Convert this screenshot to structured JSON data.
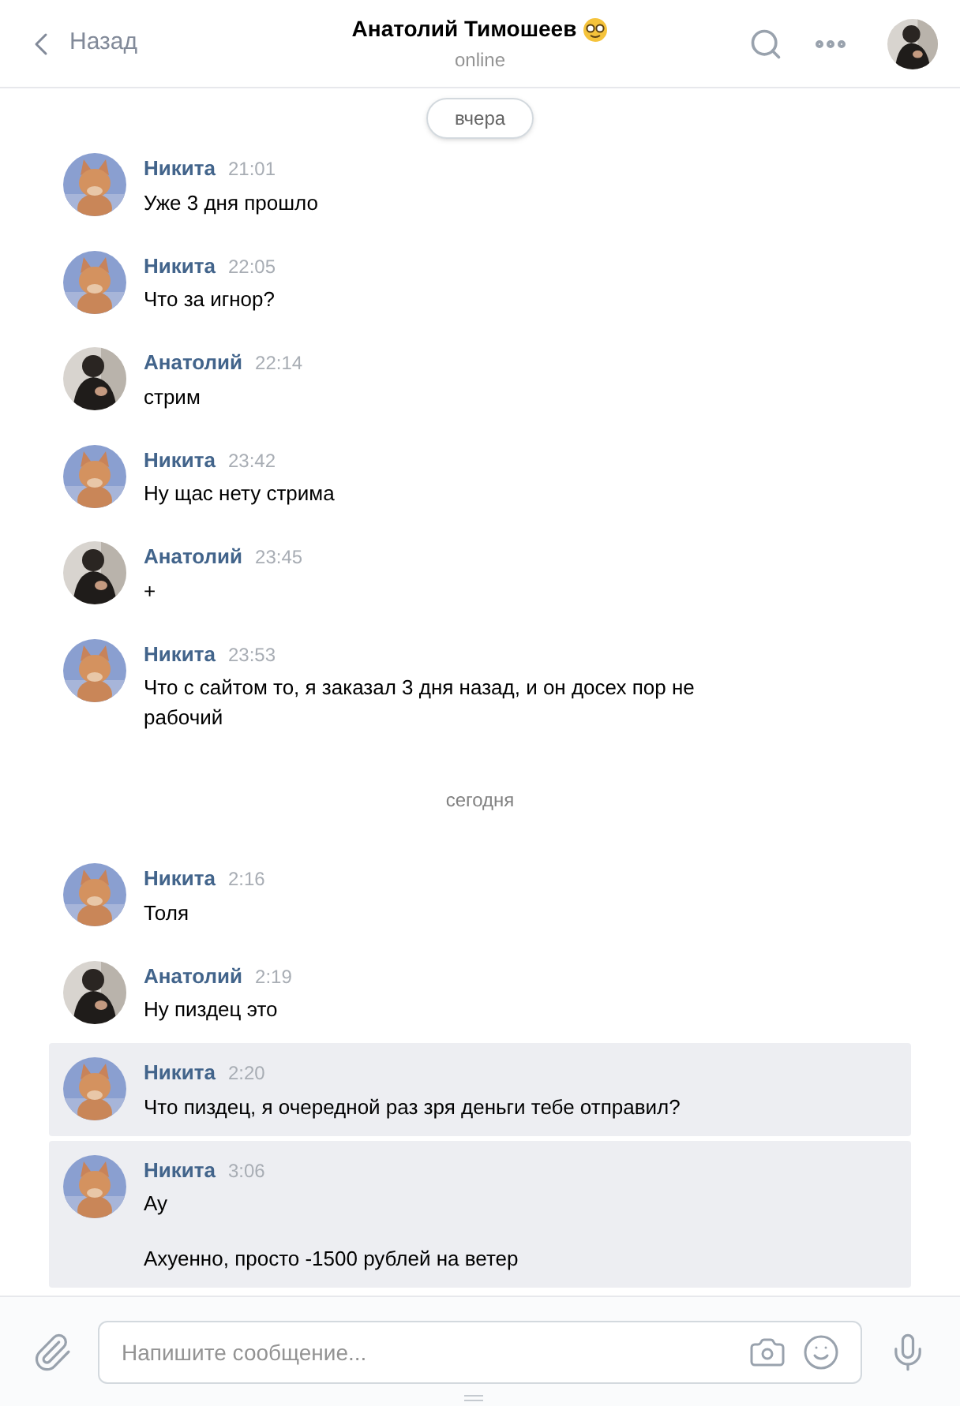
{
  "header": {
    "back_label": "Назад",
    "title": "Анатолий Тимошеев",
    "status": "online"
  },
  "feed": [
    {
      "kind": "pill_date",
      "label": "вчера"
    },
    {
      "kind": "own_message",
      "author": "Никита",
      "time": "21:01",
      "selected": false,
      "paragraphs": [
        "Уже 3 дня прошло"
      ]
    },
    {
      "kind": "own_message",
      "author": "Никита",
      "time": "22:05",
      "selected": false,
      "paragraphs": [
        "Что за игнор?"
      ]
    },
    {
      "kind": "peer_message",
      "author": "Анатолий",
      "time": "22:14",
      "selected": false,
      "paragraphs": [
        "стрим"
      ]
    },
    {
      "kind": "own_message",
      "author": "Никита",
      "time": "23:42",
      "selected": false,
      "paragraphs": [
        "Ну щас нету стрима"
      ]
    },
    {
      "kind": "peer_message",
      "author": "Анатолий",
      "time": "23:45",
      "selected": false,
      "paragraphs": [
        "+"
      ]
    },
    {
      "kind": "own_message",
      "author": "Никита",
      "time": "23:53",
      "selected": false,
      "paragraphs": [
        "Что с сайтом то, я заказал 3 дня назад, и он досех пор не рабочий"
      ]
    },
    {
      "kind": "plain_date",
      "label": "сегодня"
    },
    {
      "kind": "own_message",
      "author": "Никита",
      "time": "2:16",
      "selected": false,
      "paragraphs": [
        "Толя"
      ]
    },
    {
      "kind": "peer_message",
      "author": "Анатолий",
      "time": "2:19",
      "selected": false,
      "paragraphs": [
        "Ну пиздец это"
      ]
    },
    {
      "kind": "own_message",
      "author": "Никита",
      "time": "2:20",
      "selected": true,
      "paragraphs": [
        "Что пиздец, я очередной раз зря деньги тебе отправил?"
      ]
    },
    {
      "kind": "own_message",
      "author": "Никита",
      "time": "3:06",
      "selected": true,
      "paragraphs": [
        "Ау",
        "Ахуенно, просто -1500 рублей на ветер"
      ]
    }
  ],
  "composer": {
    "placeholder": "Напишите сообщение..."
  }
}
